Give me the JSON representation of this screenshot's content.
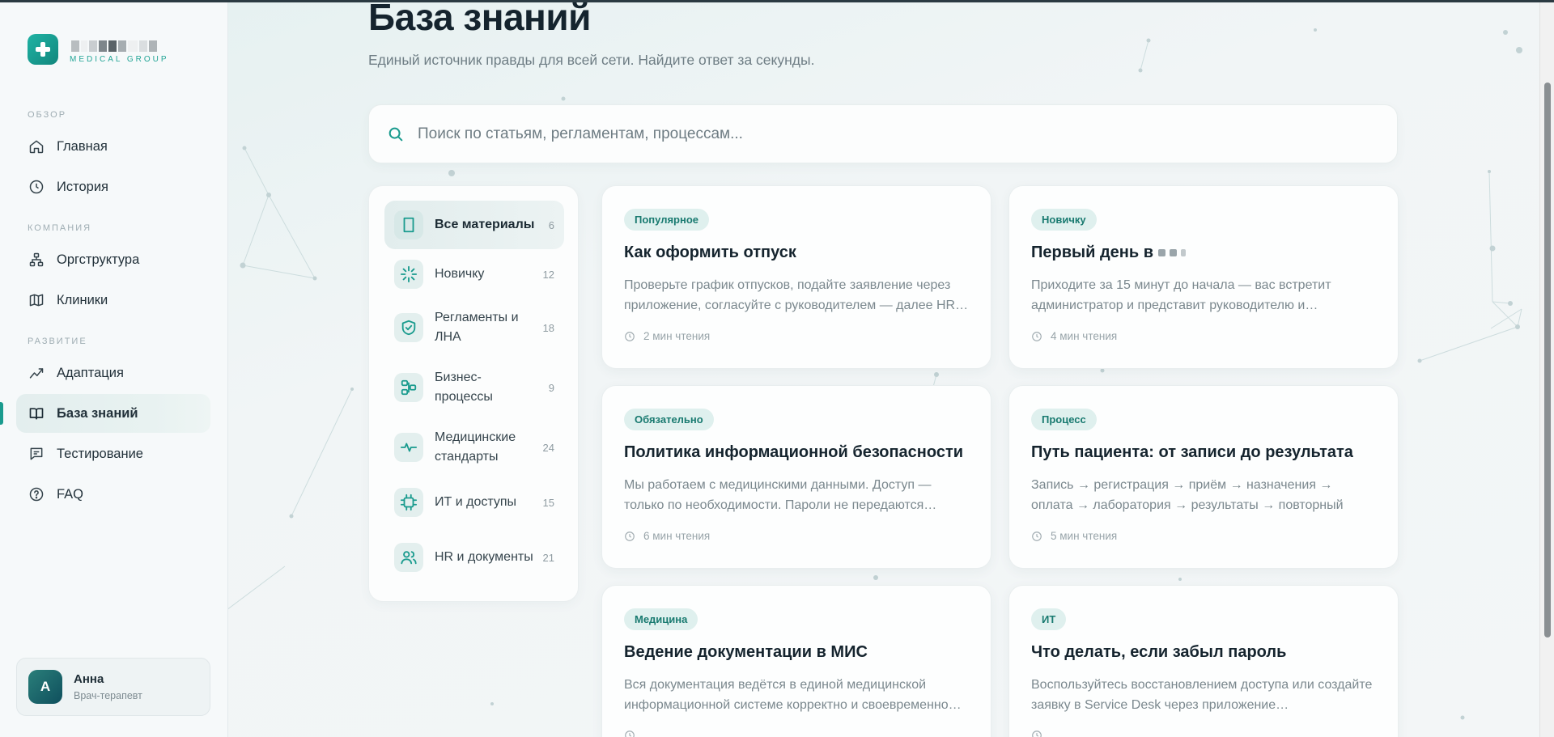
{
  "brand": {
    "subtitle": "MEDICAL GROUP"
  },
  "sidebar": {
    "sections": [
      {
        "label": "ОБЗОР"
      },
      {
        "label": "КОМПАНИЯ"
      },
      {
        "label": "РАЗВИТИЕ"
      }
    ],
    "items": [
      {
        "label": "Главная",
        "icon": "home-icon"
      },
      {
        "label": "История",
        "icon": "clock-icon"
      },
      {
        "label": "Оргструктура",
        "icon": "org-structure-icon"
      },
      {
        "label": "Клиники",
        "icon": "map-icon"
      },
      {
        "label": "Адаптация",
        "icon": "trend-icon"
      },
      {
        "label": "База знаний",
        "icon": "book-open-icon",
        "active": true
      },
      {
        "label": "Тестирование",
        "icon": "chat-icon"
      },
      {
        "label": "FAQ",
        "icon": "help-circle-icon"
      }
    ]
  },
  "user": {
    "initial": "А",
    "name": "Анна",
    "role": "Врач-терапевт"
  },
  "header": {
    "title": "База знаний",
    "subtitle": "Единый источник правды для всей сети. Найдите ответ за секунды."
  },
  "search": {
    "placeholder": "Поиск по статьям, регламентам, процессам...",
    "value": ""
  },
  "categories": [
    {
      "label": "Все материалы",
      "count": "6",
      "icon": "document-icon",
      "active": true
    },
    {
      "label": "Новичку",
      "count": "12",
      "icon": "sparkle-icon"
    },
    {
      "label": "Регламенты и ЛНА",
      "count": "18",
      "icon": "shield-check-icon"
    },
    {
      "label": "Бизнес-процессы",
      "count": "9",
      "icon": "flow-icon"
    },
    {
      "label": "Медицинские стандарты",
      "count": "24",
      "icon": "pulse-icon"
    },
    {
      "label": "ИТ и доступы",
      "count": "15",
      "icon": "chip-icon"
    },
    {
      "label": "HR и документы",
      "count": "21",
      "icon": "users-icon"
    }
  ],
  "articles": [
    {
      "badge": "Популярное",
      "title": "Как оформить отпуск",
      "text": "Проверьте график отпусков, подайте заявление через приложение, согласуйте с руководителем — далее HR…",
      "meta": "2 мин чтения"
    },
    {
      "badge": "Новичку",
      "title": "Первый день в",
      "text": "Приходите за 15 минут до начала — вас встретит администратор и представит руководителю и…",
      "meta": "4 мин чтения"
    },
    {
      "badge": "Обязательно",
      "title": "Политика информационной безопасности",
      "text": "Мы работаем с медицинскими данными. Доступ — только по необходимости. Пароли не передаются…",
      "meta": "6 мин чтения"
    },
    {
      "badge": "Процесс",
      "title": "Путь пациента: от записи до результата",
      "text": "Запись → регистрация → приём → назначения → оплата → лаборатория → результаты → повторный приём →…",
      "meta": "5 мин чтения"
    },
    {
      "badge": "Медицина",
      "title": "Ведение документации в МИС",
      "text": "Вся документация ведётся в единой медицинской информационной системе корректно и своевременно…",
      "meta": ""
    },
    {
      "badge": "ИТ",
      "title": "Что делать, если забыл пароль",
      "text": "Воспользуйтесь восстановлением доступа или создайте заявку в Service Desk через приложение…",
      "meta": ""
    }
  ],
  "colors": {
    "accent": "#1a9b8e",
    "badge_bg": "#dff0ee",
    "badge_text": "#197a70"
  }
}
